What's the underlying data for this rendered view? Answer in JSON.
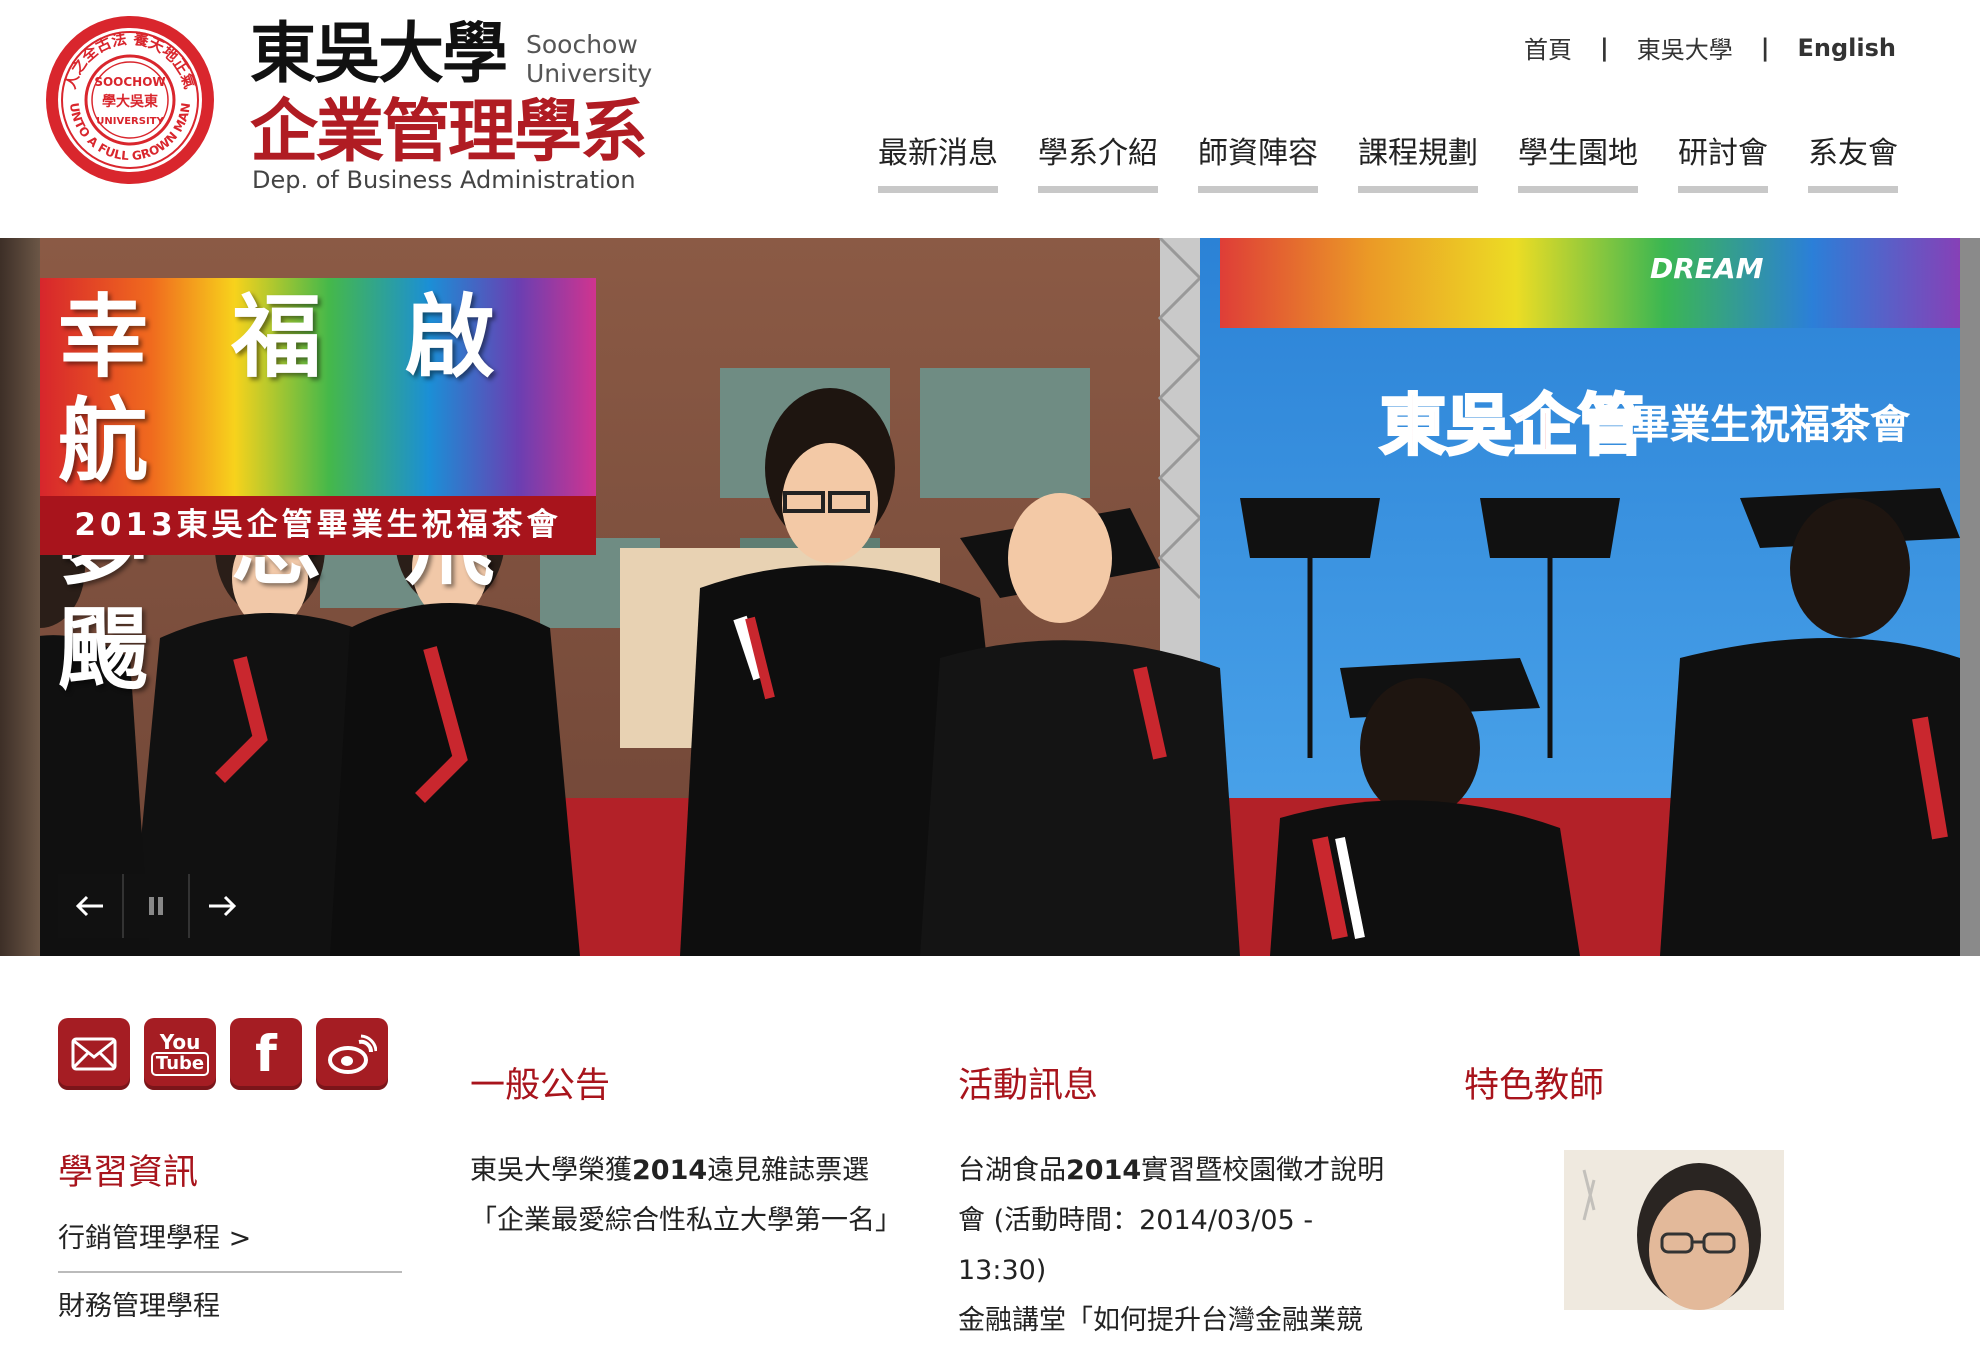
{
  "header": {
    "logo": {
      "seal_top_text": "人之全古法 養天地正氣",
      "seal_center_text": "SOOCHOW UNIVERSITY 東吳大學",
      "seal_bottom_text": "UNTO A FULL GROWN MAN",
      "university_zh": "東吳大學",
      "university_en_line1": "Soochow",
      "university_en_line2": "University",
      "dept_zh": "企業管理學系",
      "dept_en": "Dep. of Business Administration"
    },
    "toplinks": [
      {
        "label": "首頁"
      },
      {
        "label": "東吳大學"
      },
      {
        "label": "English"
      }
    ],
    "nav": [
      {
        "label": "最新消息"
      },
      {
        "label": "學系介紹"
      },
      {
        "label": "師資陣容"
      },
      {
        "label": "課程規劃"
      },
      {
        "label": "學生園地"
      },
      {
        "label": "研討會"
      },
      {
        "label": "系友會"
      }
    ]
  },
  "banner": {
    "title_line1": "幸 福 啟 航",
    "title_line2": "夢 想 飛 颺",
    "subtitle": "2013東吳企管畢業生祝福茶會",
    "stage_sign_main": "東吳企管",
    "stage_sign_sub": "畢業生祝福茶會",
    "stage_sign_dream": "DREAM",
    "controls": {
      "prev_icon": "arrow-left-icon",
      "pause_icon": "pause-icon",
      "next_icon": "arrow-right-icon"
    }
  },
  "social": [
    {
      "name": "mail-icon"
    },
    {
      "name": "youtube-icon",
      "label_top": "You",
      "label_bottom": "Tube"
    },
    {
      "name": "facebook-icon",
      "label": "f"
    },
    {
      "name": "weibo-icon"
    }
  ],
  "sidebar": {
    "title": "學習資訊",
    "items": [
      {
        "label": "行銷管理學程 >"
      },
      {
        "label": "財務管理學程"
      }
    ]
  },
  "announcements": {
    "title": "一般公告",
    "items": [
      {
        "prefix": "東吳大學榮獲",
        "bold": "2014",
        "suffix": "遠見雜誌票選「企業最愛綜合性私立大學第一名」"
      }
    ]
  },
  "events": {
    "title": "活動訊息",
    "items": [
      {
        "prefix": "台湖食品",
        "bold": "2014",
        "suffix": "實習暨校園徵才說明會 (活動時間：2014/03/05 - 13:30)"
      },
      {
        "text": "金融講堂「如何提升台灣金融業競"
      }
    ]
  },
  "featured": {
    "title": "特色教師"
  },
  "colors": {
    "brand_red": "#a8141c",
    "nav_underline": "#c8c8c8",
    "social_bg": "#a51d23"
  }
}
